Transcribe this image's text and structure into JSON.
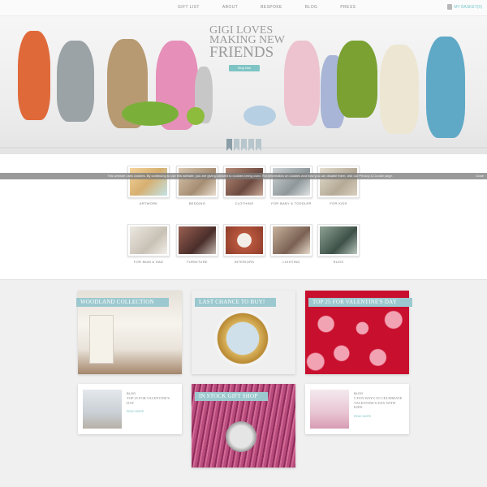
{
  "nav": {
    "items": [
      "Gift List",
      "About",
      "Bespoke",
      "Blog",
      "Press"
    ],
    "basket": "My Basket(0)"
  },
  "hero": {
    "title_line1": "Gigi Loves",
    "title_line2": "Making New",
    "title_line3": "Friends",
    "button": "Shop Now"
  },
  "cookie": {
    "message": "This website uses cookies. By continuing to use this website, you are giving consent to cookies being used. For information on cookies and how you can disable them, visit our Privacy & Cookie page.",
    "close": "Close"
  },
  "categories": [
    {
      "label": "Artwork",
      "color": "#e9c48c"
    },
    {
      "label": "Bedding",
      "color": "#b9a48d"
    },
    {
      "label": "Clothing",
      "color": "#8e6a5c"
    },
    {
      "label": "For Baby & Toddler",
      "color": "#a8b0b3"
    },
    {
      "label": "For Kids",
      "color": "#c9c1b2"
    },
    {
      "label": "For Mum & Dad",
      "color": "#d8d2c8"
    },
    {
      "label": "Furniture",
      "color": "#7a4d43"
    },
    {
      "label": "Interiors",
      "color": "#b8573e"
    },
    {
      "label": "Lighting",
      "color": "#9b8170"
    },
    {
      "label": "Rugs",
      "color": "#5c6f64"
    }
  ],
  "features": {
    "woodland": "Woodland Collection",
    "last_chance": "Last Chance to Buy!",
    "valentines": "Top 25 for Valentine's Day",
    "in_stock": "In Stock Gift Shop"
  },
  "blogs": [
    {
      "tag": "Blog",
      "title": "Top 25 for Valentine's Day",
      "more": "Read More"
    },
    {
      "tag": "Blog",
      "title": "5 Fun Ways to Celebrate Valentine's Day with Kids",
      "more": "Read More"
    }
  ],
  "colors": {
    "accent": "#7fc4c4",
    "banner": "#9cc9cf",
    "valentine_red": "#c8102e",
    "heart": "#f2a3b3"
  }
}
